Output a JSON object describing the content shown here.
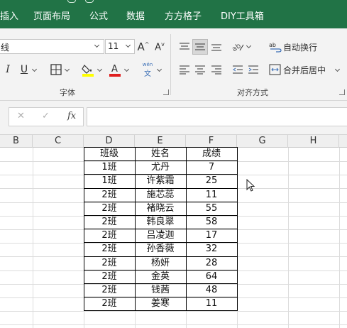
{
  "ribbon_tabs": [
    {
      "label": "插入"
    },
    {
      "label": "页面布局"
    },
    {
      "label": "公式"
    },
    {
      "label": "数据"
    },
    {
      "label": "方方格子"
    },
    {
      "label": "DIY工具箱"
    }
  ],
  "font": {
    "name_value": "线",
    "size_value": "11",
    "group_label": "字体"
  },
  "alignment": {
    "wrap_text_label": "自动换行",
    "merge_center_label": "合并后居中",
    "group_label": "对齐方式",
    "phonetic_glyph": "wén"
  },
  "formula_bar": {
    "cancel_glyph": "✕",
    "enter_glyph": "✓",
    "fx_glyph": "fx",
    "value": ""
  },
  "columns": [
    "B",
    "C",
    "D",
    "E",
    "F",
    "G",
    "H"
  ],
  "sheet_table": {
    "headers": [
      "班级",
      "姓名",
      "成绩"
    ],
    "rows": [
      [
        "1班",
        "尤丹",
        "7"
      ],
      [
        "1班",
        "许紫霜",
        "25"
      ],
      [
        "2班",
        "施芯蕊",
        "11"
      ],
      [
        "2班",
        "褚晓云",
        "55"
      ],
      [
        "2班",
        "韩良翠",
        "58"
      ],
      [
        "2班",
        "吕凌迦",
        "17"
      ],
      [
        "2班",
        "孙香薇",
        "32"
      ],
      [
        "2班",
        "杨妍",
        "28"
      ],
      [
        "2班",
        "金英",
        "64"
      ],
      [
        "2班",
        "钱茜",
        "48"
      ],
      [
        "2班",
        "姜寒",
        "11"
      ]
    ]
  },
  "colors": {
    "ribbon_green": "#217346",
    "highlight_yellow": "#ffff00",
    "font_red": "#e02020"
  }
}
